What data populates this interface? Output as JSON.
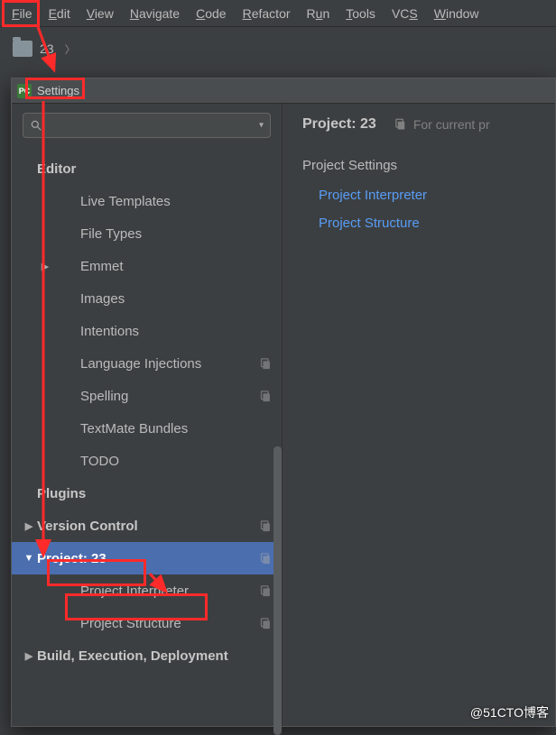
{
  "menubar": [
    "File",
    "Edit",
    "View",
    "Navigate",
    "Code",
    "Refactor",
    "Run",
    "Tools",
    "VCS",
    "Window"
  ],
  "menubar_underline": [
    "F",
    "E",
    "V",
    "N",
    "C",
    "R",
    "u",
    "T",
    "S",
    "W"
  ],
  "toolbar": {
    "project": "23"
  },
  "dialog": {
    "title": "Settings",
    "search_placeholder": "",
    "content": {
      "title": "Project: 23",
      "scope": "For current pr",
      "section": "Project Settings",
      "links": [
        "Project Interpreter",
        "Project Structure"
      ]
    }
  },
  "tree": [
    {
      "label": "Editor",
      "level": 0,
      "cat": true,
      "arrow": "",
      "copy": false
    },
    {
      "label": "Live Templates",
      "level": 1,
      "cat": false,
      "arrow": "",
      "copy": false
    },
    {
      "label": "File Types",
      "level": 1,
      "cat": false,
      "arrow": "",
      "copy": false
    },
    {
      "label": "Emmet",
      "level": 1,
      "cat": false,
      "arrow": "▶",
      "copy": false
    },
    {
      "label": "Images",
      "level": 1,
      "cat": false,
      "arrow": "",
      "copy": false
    },
    {
      "label": "Intentions",
      "level": 1,
      "cat": false,
      "arrow": "",
      "copy": false
    },
    {
      "label": "Language Injections",
      "level": 1,
      "cat": false,
      "arrow": "",
      "copy": true
    },
    {
      "label": "Spelling",
      "level": 1,
      "cat": false,
      "arrow": "",
      "copy": true
    },
    {
      "label": "TextMate Bundles",
      "level": 1,
      "cat": false,
      "arrow": "",
      "copy": false
    },
    {
      "label": "TODO",
      "level": 1,
      "cat": false,
      "arrow": "",
      "copy": false
    },
    {
      "label": "Plugins",
      "level": 0,
      "cat": true,
      "arrow": "",
      "copy": false
    },
    {
      "label": "Version Control",
      "level": 0,
      "cat": true,
      "arrow": "▶",
      "copy": true
    },
    {
      "label": "Project: 23",
      "level": 0,
      "cat": true,
      "arrow": "▼",
      "copy": true,
      "selected": true
    },
    {
      "label": "Project Interpreter",
      "level": 1,
      "cat": false,
      "arrow": "",
      "copy": true
    },
    {
      "label": "Project Structure",
      "level": 1,
      "cat": false,
      "arrow": "",
      "copy": true
    },
    {
      "label": "Build, Execution, Deployment",
      "level": 0,
      "cat": true,
      "arrow": "▶",
      "copy": false
    }
  ],
  "watermark": "@51CTO博客"
}
